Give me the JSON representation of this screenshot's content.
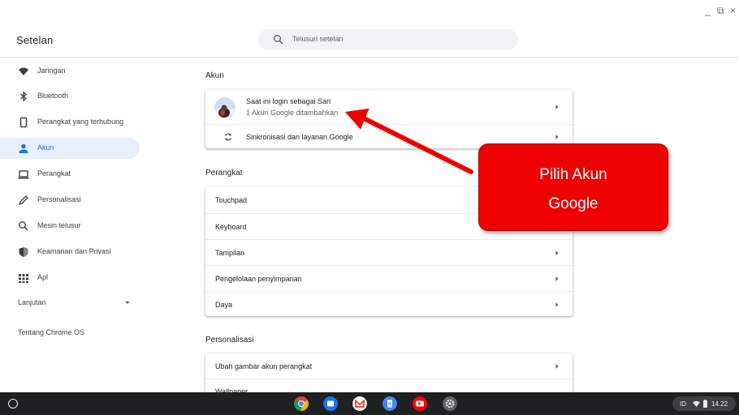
{
  "window": {
    "controls": [
      "_",
      "⧉",
      "×"
    ]
  },
  "header": {
    "title": "Setelan",
    "search_placeholder": "Telusuri setelan"
  },
  "sidebar": {
    "items": [
      {
        "label": "Jaringan",
        "icon": "wifi-icon"
      },
      {
        "label": "Bluetooth",
        "icon": "bluetooth-icon"
      },
      {
        "label": "Perangkat yang terhubung",
        "icon": "phone-icon"
      },
      {
        "label": "Akun",
        "icon": "person-icon",
        "active": true
      },
      {
        "label": "Perangkat",
        "icon": "laptop-icon"
      },
      {
        "label": "Personalisasi",
        "icon": "pen-icon"
      },
      {
        "label": "Mesin telusur",
        "icon": "search-icon"
      },
      {
        "label": "Keamanan dan Privasi",
        "icon": "shield-icon"
      },
      {
        "label": "Apl",
        "icon": "apps-grid-icon"
      }
    ],
    "advanced": "Lanjutan",
    "about": "Tentang Chrome OS"
  },
  "main": {
    "accounts": {
      "title": "Akun",
      "account_name": "Saat ini login sebagai Sari",
      "account_sub": "1 Akun Google ditambahkan",
      "sync": "Sinkronisasi dan layanan Google"
    },
    "device": {
      "title": "Perangkat",
      "rows": [
        "Touchpad",
        "Keyboard",
        "Tampilan",
        "Pengelolaan penyimpanan",
        "Daya"
      ]
    },
    "personalization": {
      "title": "Personalisasi",
      "rows": [
        "Ubah gambar akun perangkat",
        "Wallpaper"
      ]
    }
  },
  "annotation": {
    "line1": "Pilih Akun",
    "line2": "Google",
    "color": "#ee0000"
  },
  "shelf": {
    "apps": [
      "chrome-icon",
      "files-icon",
      "gmail-icon",
      "docs-icon",
      "youtube-icon",
      "settings-icon"
    ],
    "tray": {
      "lang": "ID",
      "time": "14.22"
    }
  }
}
